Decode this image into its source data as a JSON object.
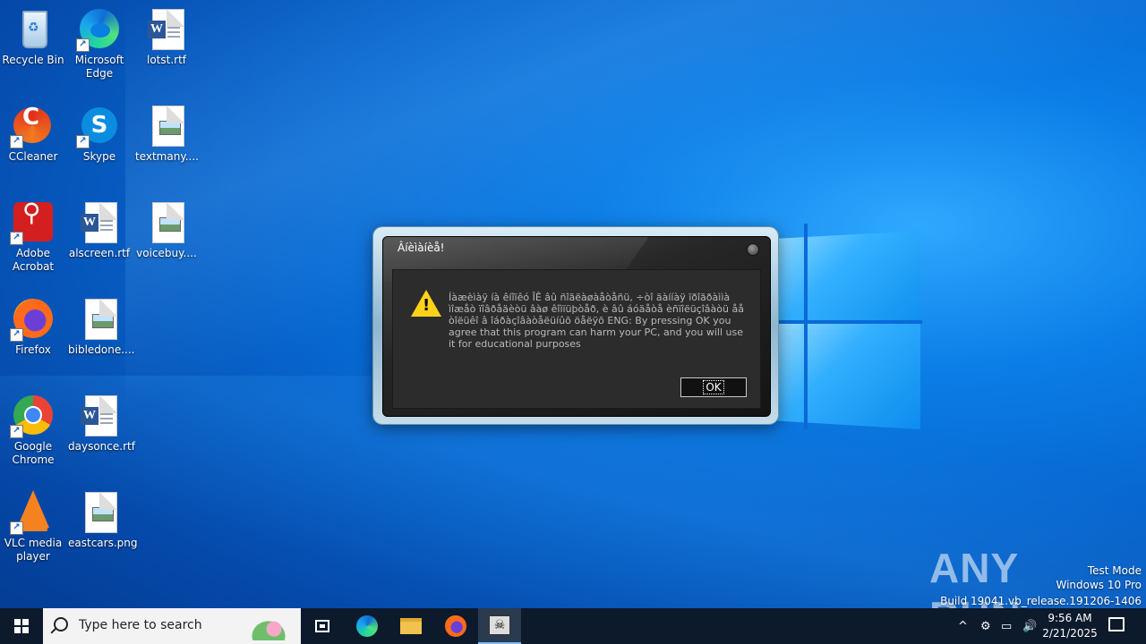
{
  "desktop": {
    "icons": [
      {
        "label": "Recycle Bin"
      },
      {
        "label": "Microsoft Edge"
      },
      {
        "label": "lotst.rtf"
      },
      {
        "label": "CCleaner"
      },
      {
        "label": "Skype"
      },
      {
        "label": "textmany...."
      },
      {
        "label": "Adobe Acrobat"
      },
      {
        "label": "alscreen.rtf"
      },
      {
        "label": "voicebuy...."
      },
      {
        "label": "Firefox"
      },
      {
        "label": "bibledone...."
      },
      {
        "label": "Google Chrome"
      },
      {
        "label": "daysonce.rtf"
      },
      {
        "label": "VLC media player"
      },
      {
        "label": "eastcars.png"
      }
    ]
  },
  "dialog": {
    "title": "Âíèìàíèå!",
    "message": "Íàæèìàÿ íà êíîïêó ÎÊ âû ñîãëàøàåòåñü, ÷òî äàííàÿ ïðîãðàììà ìîæåò ïîâðåäèòü âàø êîìïüþòåð, è âû áóäåòå èñïîëüçîâàòü åå òîëüêî â îáðàçîâàòåëüíûõ öåëÿõ ENG: By pressing OK you agree that this program can harm your PC, and you will use it for educational purposes",
    "ok_label": "OK"
  },
  "watermark": {
    "brand": "ANY RUN",
    "line1": "Test Mode",
    "line2": "Windows 10 Pro",
    "line3": "Build 19041.vb_release.191206-1406"
  },
  "taskbar": {
    "search_placeholder": "Type here to search",
    "time": "9:56 AM",
    "date": "2/21/2025"
  },
  "icons_semantic": {
    "start": "windows-start-icon",
    "search": "search-icon",
    "taskview": "task-view-icon",
    "edge": "edge-icon",
    "explorer": "folder-icon",
    "firefox": "firefox-icon",
    "app": "malware-app-icon"
  }
}
